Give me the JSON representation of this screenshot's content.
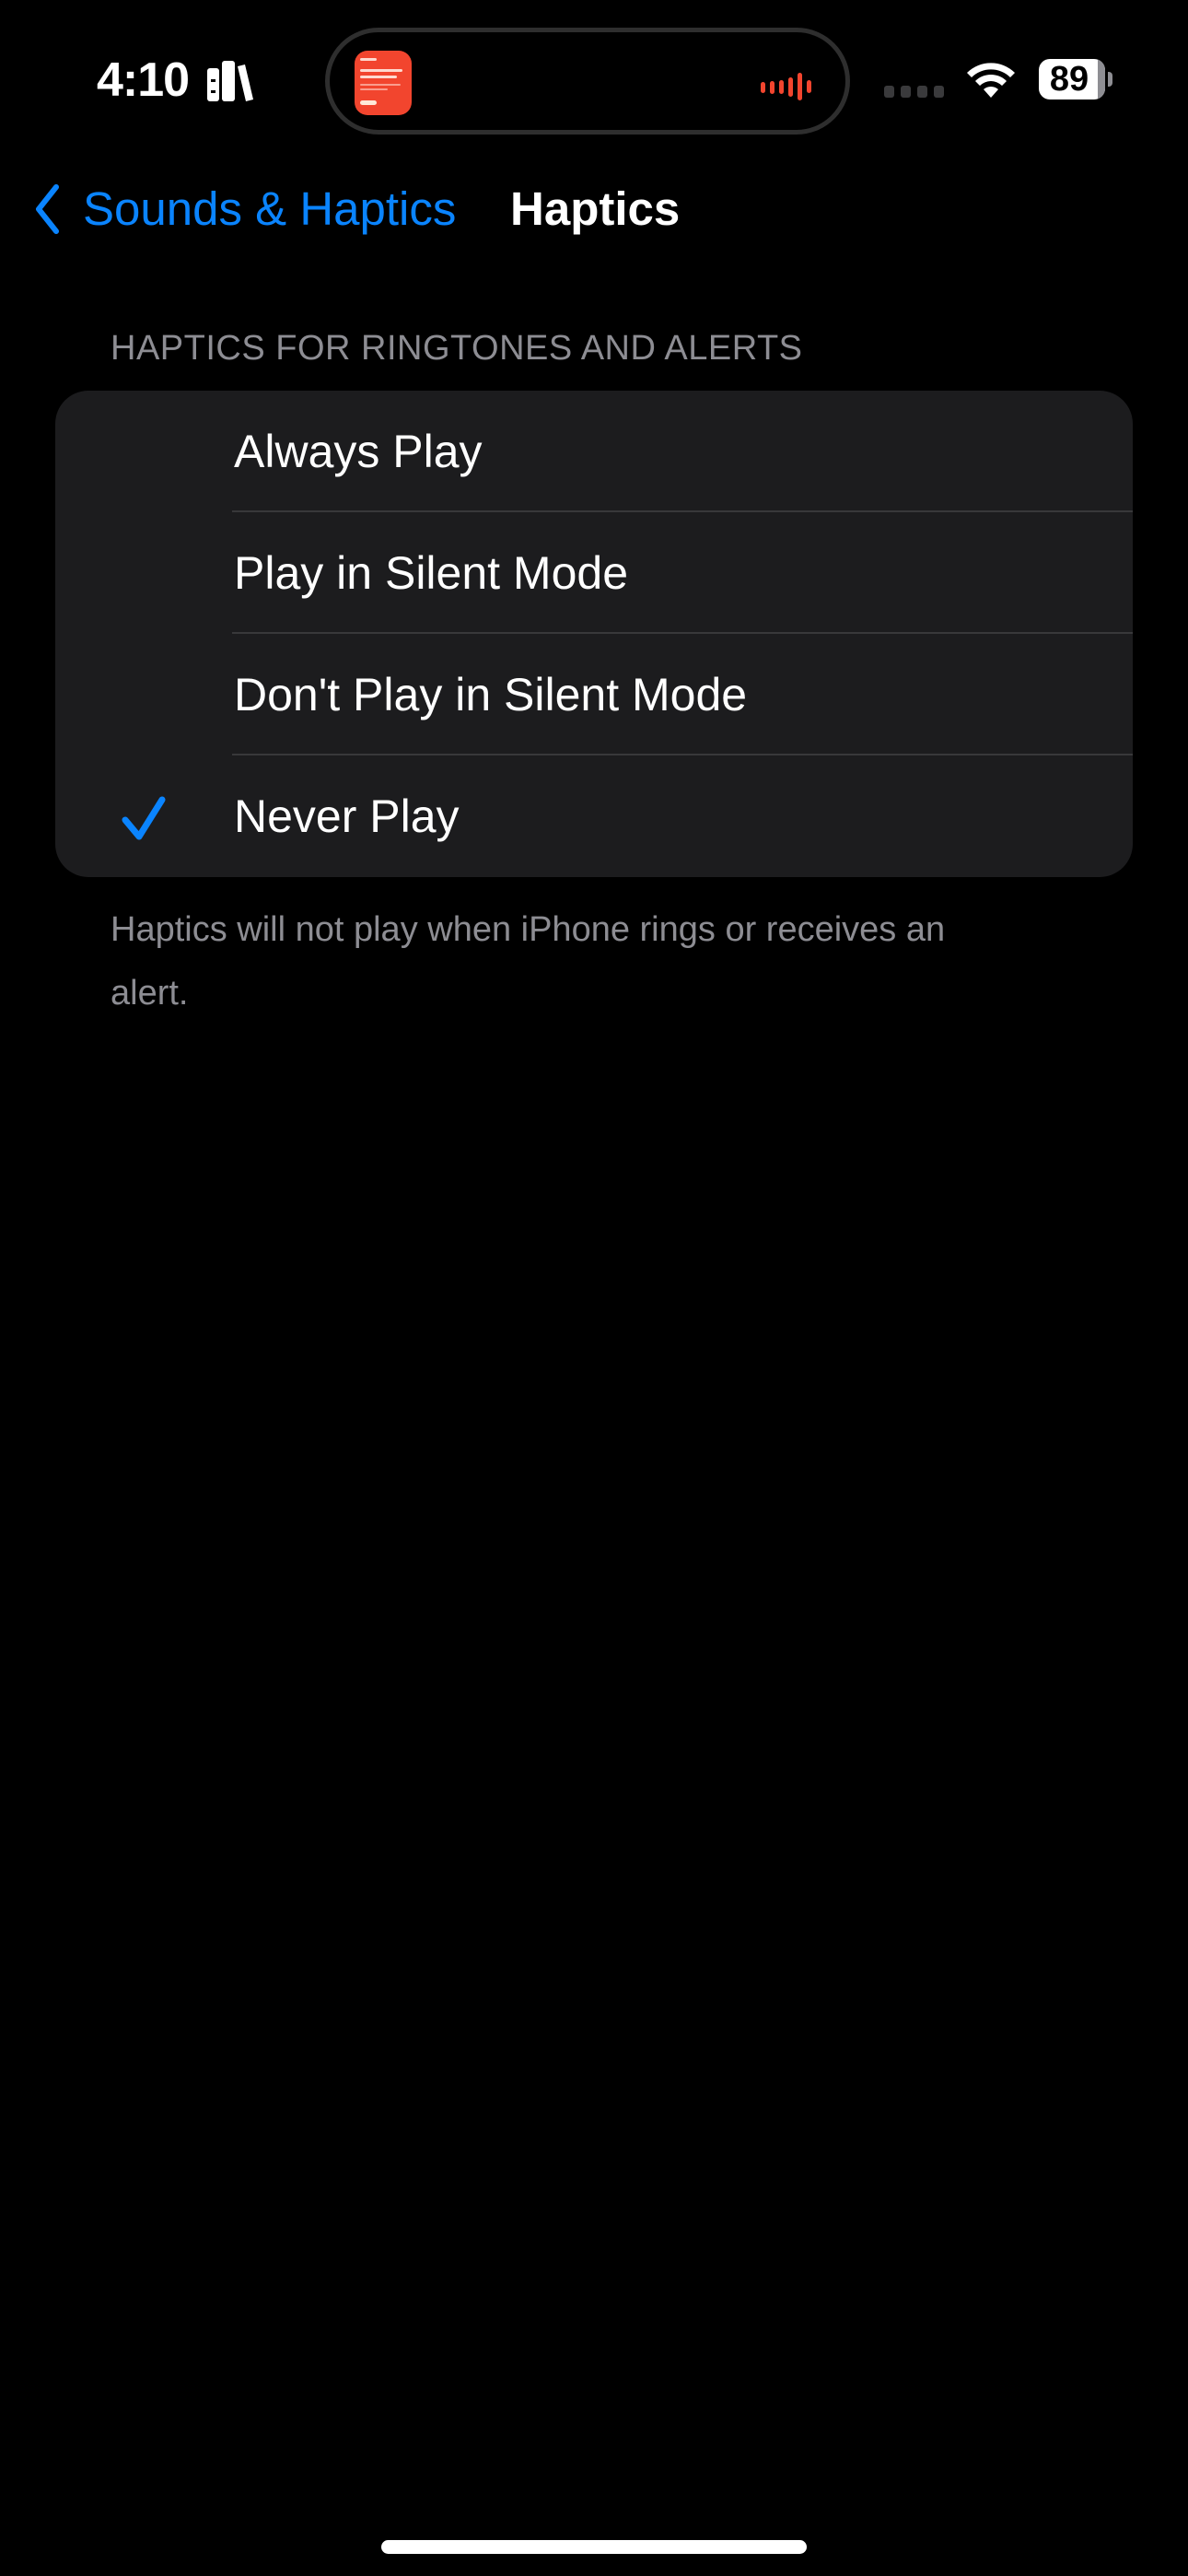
{
  "status_bar": {
    "time": "4:10",
    "activity_icon": "books-icon",
    "dynamic_island": {
      "artwork_icon": "podcast-artwork",
      "waveform_icon": "audio-waveform-icon",
      "accent_color": "#f2452e"
    },
    "cellular_icon": "no-signal-dots",
    "wifi_icon": "wifi-icon",
    "battery": {
      "percent": 89,
      "label": "89"
    }
  },
  "nav": {
    "back_icon": "chevron-left-icon",
    "back_label": "Sounds & Haptics",
    "title": "Haptics",
    "accent_color": "#0a84ff"
  },
  "section": {
    "header": "HAPTICS FOR RINGTONES AND ALERTS",
    "options": [
      {
        "label": "Always Play",
        "selected": false
      },
      {
        "label": "Play in Silent Mode",
        "selected": false
      },
      {
        "label": "Don't Play in Silent Mode",
        "selected": false
      },
      {
        "label": "Never Play",
        "selected": true
      }
    ],
    "footer": "Haptics will not play when iPhone rings or receives an alert."
  }
}
